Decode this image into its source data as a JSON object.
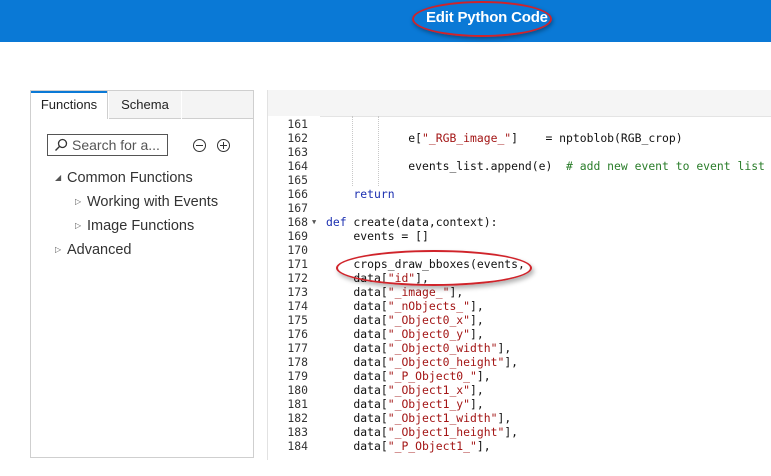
{
  "header": {
    "title": "Edit Python Code"
  },
  "left_panel": {
    "tabs": [
      {
        "label": "Functions",
        "active": true
      },
      {
        "label": "Schema",
        "active": false
      }
    ],
    "search": {
      "placeholder": "Search for a..."
    },
    "tree": [
      {
        "label": "Common Functions",
        "expanded": true
      },
      {
        "label": "Working with Events",
        "expanded": false
      },
      {
        "label": "Image Functions",
        "expanded": false
      },
      {
        "label": "Advanced",
        "expanded": false
      }
    ]
  },
  "editor": {
    "lines": [
      {
        "n": "161",
        "parts": []
      },
      {
        "n": "162",
        "parts": [
          {
            "t": "            e[",
            "c": "code"
          },
          {
            "t": "\"_RGB_image_\"",
            "c": "str"
          },
          {
            "t": "]    = nptoblob(RGB_crop)",
            "c": "code"
          }
        ]
      },
      {
        "n": "163",
        "parts": []
      },
      {
        "n": "164",
        "parts": [
          {
            "t": "            events_list.append(e)  ",
            "c": "code"
          },
          {
            "t": "# add new event to event list",
            "c": "cm"
          }
        ]
      },
      {
        "n": "165",
        "parts": []
      },
      {
        "n": "166",
        "parts": [
          {
            "t": "    ",
            "c": "code"
          },
          {
            "t": "return",
            "c": "kw"
          }
        ]
      },
      {
        "n": "167",
        "parts": []
      },
      {
        "n": "168",
        "fold": true,
        "parts": [
          {
            "t": "def",
            "c": "kw"
          },
          {
            "t": " create(data,context):",
            "c": "code"
          }
        ]
      },
      {
        "n": "169",
        "parts": [
          {
            "t": "    events = []",
            "c": "code"
          }
        ]
      },
      {
        "n": "170",
        "parts": []
      },
      {
        "n": "171",
        "parts": [
          {
            "t": "    crops_draw_bboxes(events,",
            "c": "code"
          }
        ]
      },
      {
        "n": "172",
        "parts": [
          {
            "t": "    data[",
            "c": "code"
          },
          {
            "t": "\"id\"",
            "c": "str"
          },
          {
            "t": "],",
            "c": "code"
          }
        ]
      },
      {
        "n": "173",
        "parts": [
          {
            "t": "    data[",
            "c": "code"
          },
          {
            "t": "\"_image_\"",
            "c": "str"
          },
          {
            "t": "],",
            "c": "code"
          }
        ]
      },
      {
        "n": "174",
        "parts": [
          {
            "t": "    data[",
            "c": "code"
          },
          {
            "t": "\"_nObjects_\"",
            "c": "str"
          },
          {
            "t": "],",
            "c": "code"
          }
        ]
      },
      {
        "n": "175",
        "parts": [
          {
            "t": "    data[",
            "c": "code"
          },
          {
            "t": "\"_Object0_x\"",
            "c": "str"
          },
          {
            "t": "],",
            "c": "code"
          }
        ]
      },
      {
        "n": "176",
        "parts": [
          {
            "t": "    data[",
            "c": "code"
          },
          {
            "t": "\"_Object0_y\"",
            "c": "str"
          },
          {
            "t": "],",
            "c": "code"
          }
        ]
      },
      {
        "n": "177",
        "parts": [
          {
            "t": "    data[",
            "c": "code"
          },
          {
            "t": "\"_Object0_width\"",
            "c": "str"
          },
          {
            "t": "],",
            "c": "code"
          }
        ]
      },
      {
        "n": "178",
        "parts": [
          {
            "t": "    data[",
            "c": "code"
          },
          {
            "t": "\"_Object0_height\"",
            "c": "str"
          },
          {
            "t": "],",
            "c": "code"
          }
        ]
      },
      {
        "n": "179",
        "parts": [
          {
            "t": "    data[",
            "c": "code"
          },
          {
            "t": "\"_P_Object0_\"",
            "c": "str"
          },
          {
            "t": "],",
            "c": "code"
          }
        ]
      },
      {
        "n": "180",
        "parts": [
          {
            "t": "    data[",
            "c": "code"
          },
          {
            "t": "\"_Object1_x\"",
            "c": "str"
          },
          {
            "t": "],",
            "c": "code"
          }
        ]
      },
      {
        "n": "181",
        "parts": [
          {
            "t": "    data[",
            "c": "code"
          },
          {
            "t": "\"_Object1_y\"",
            "c": "str"
          },
          {
            "t": "],",
            "c": "code"
          }
        ]
      },
      {
        "n": "182",
        "parts": [
          {
            "t": "    data[",
            "c": "code"
          },
          {
            "t": "\"_Object1_width\"",
            "c": "str"
          },
          {
            "t": "],",
            "c": "code"
          }
        ]
      },
      {
        "n": "183",
        "parts": [
          {
            "t": "    data[",
            "c": "code"
          },
          {
            "t": "\"_Object1_height\"",
            "c": "str"
          },
          {
            "t": "],",
            "c": "code"
          }
        ]
      },
      {
        "n": "184",
        "parts": [
          {
            "t": "    data[",
            "c": "code"
          },
          {
            "t": "\"_P_Object1_\"",
            "c": "str"
          },
          {
            "t": "],",
            "c": "code"
          }
        ]
      }
    ]
  },
  "colors": {
    "header_bg": "#0a79d6",
    "annotation": "#d0232a",
    "keyword": "#1b2fb0",
    "string": "#a31515",
    "comment": "#2a7d2a"
  }
}
